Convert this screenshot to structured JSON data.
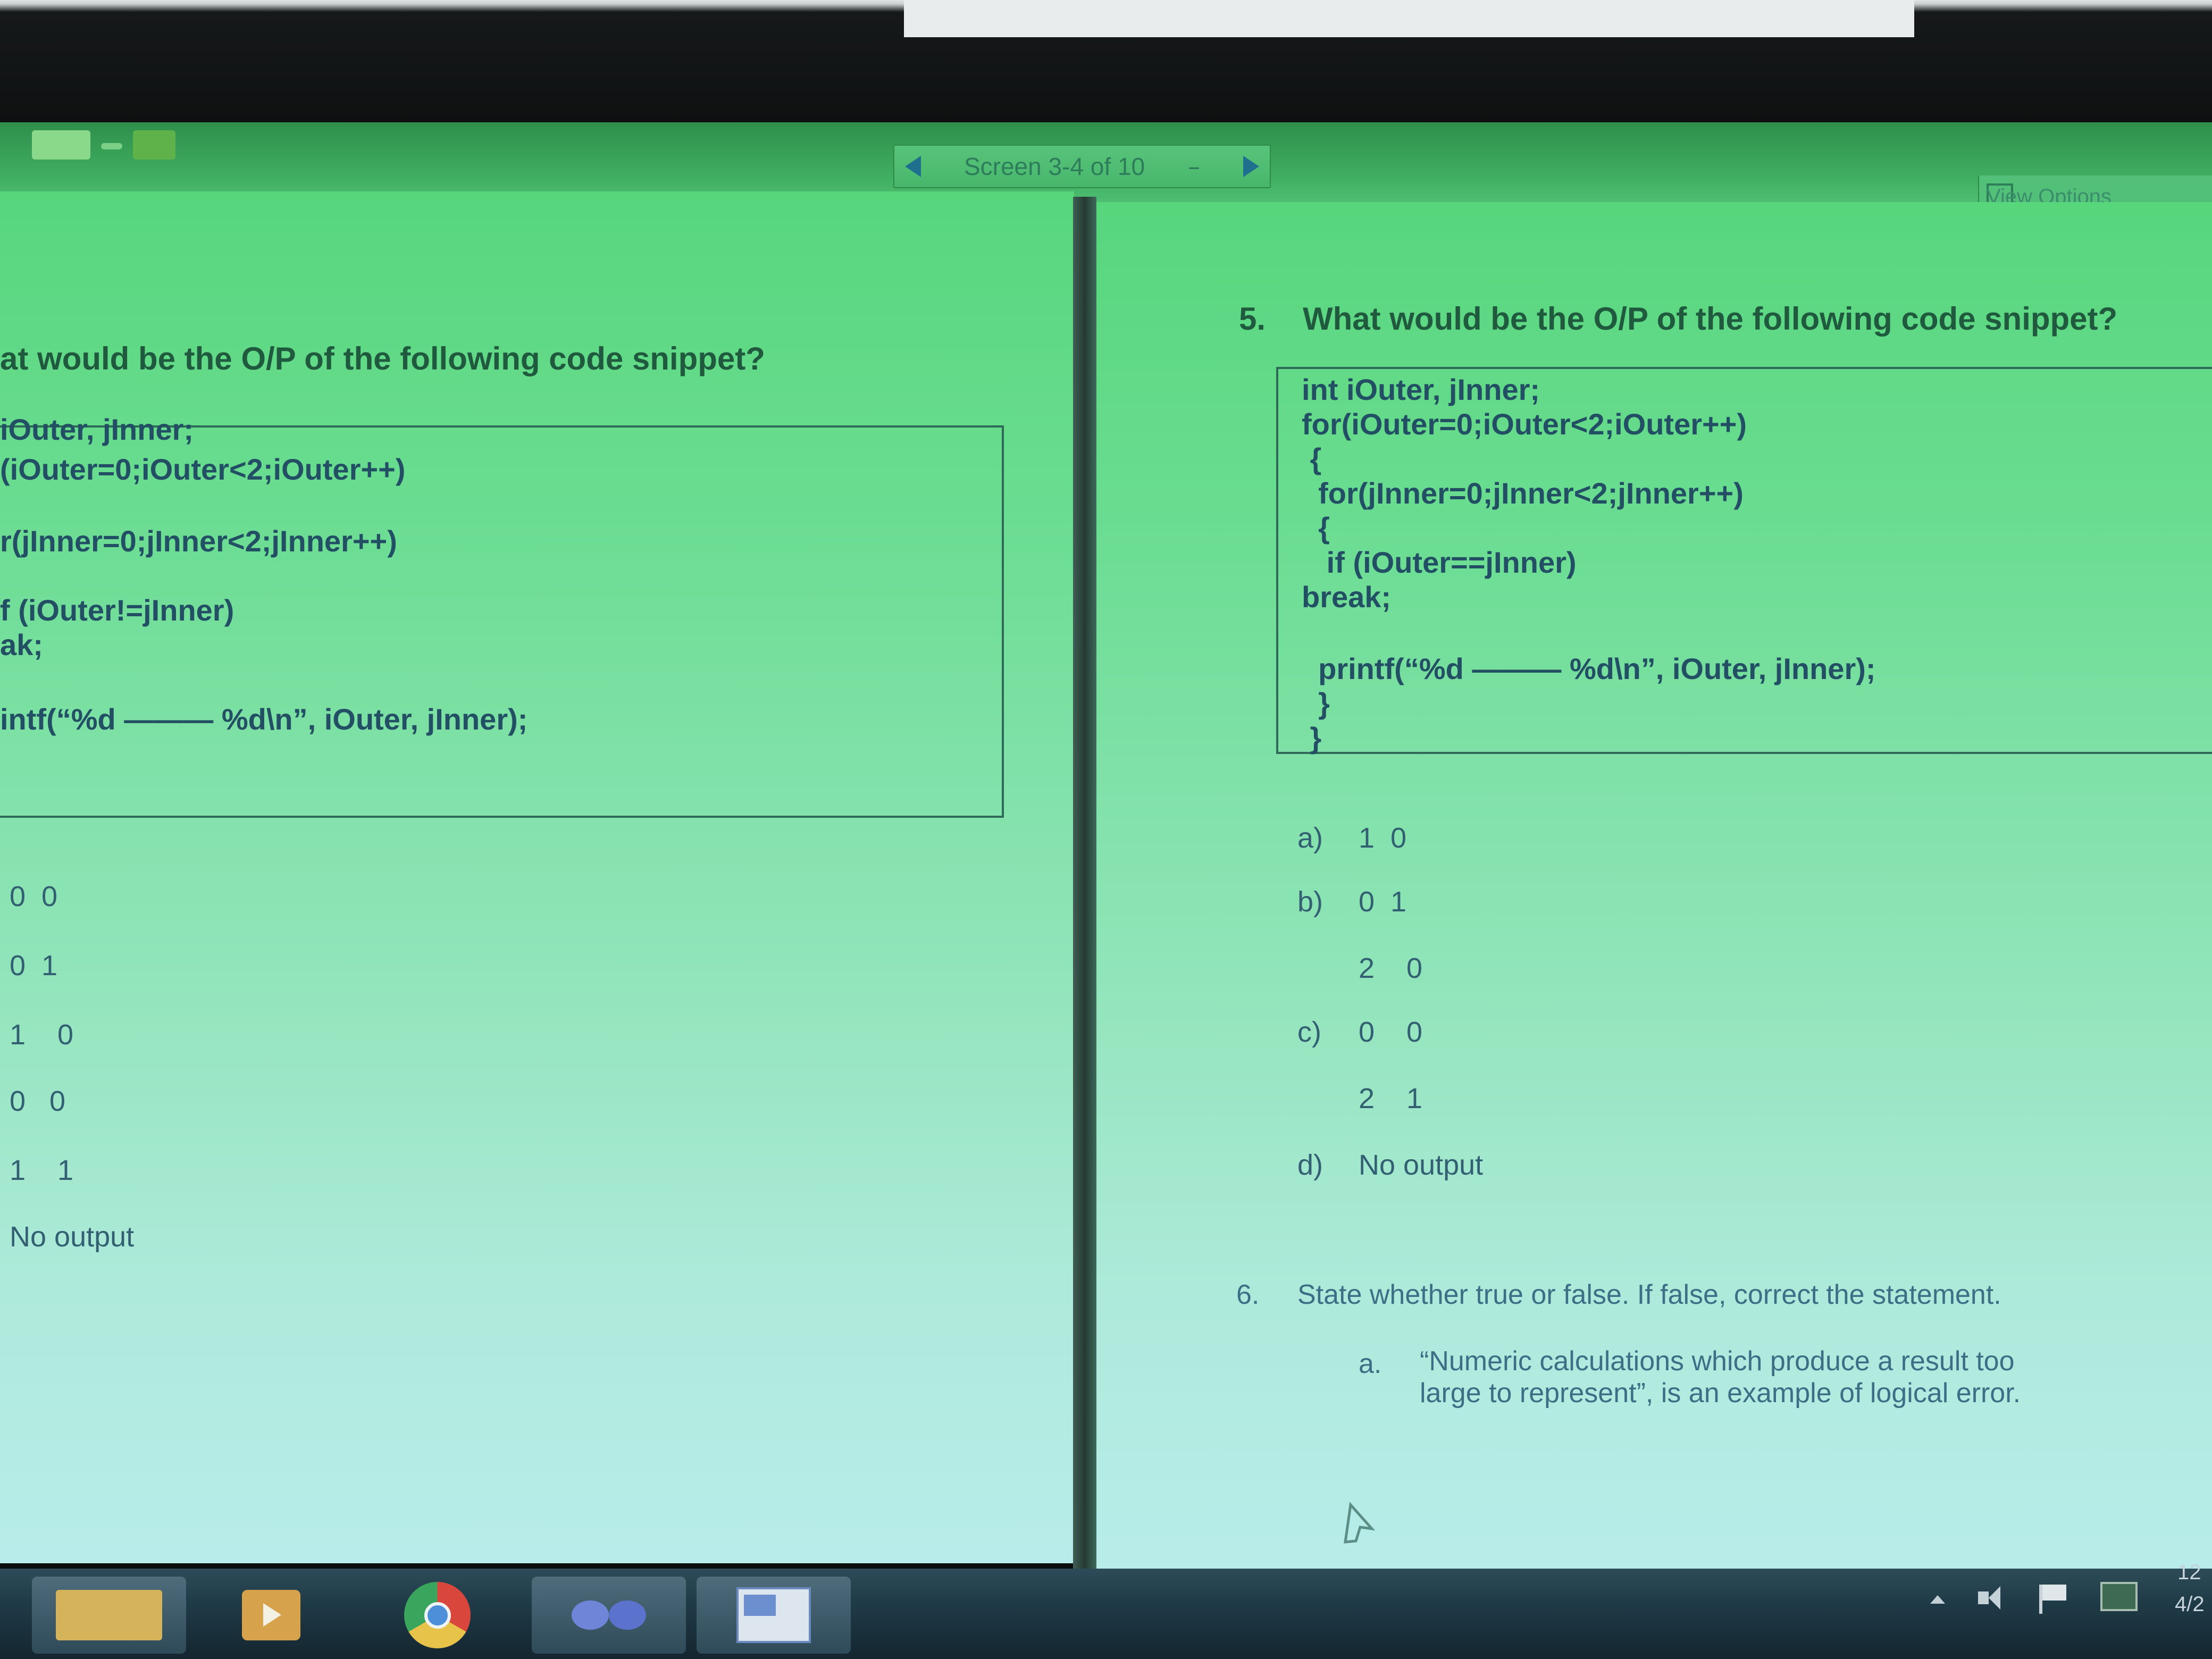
{
  "nav": {
    "screen_label": "Screen 3-4 of 10",
    "dash": "–"
  },
  "view_options": {
    "label": "View Options"
  },
  "left_page": {
    "question_title": "at would be the O/P of the following code snippet?",
    "code_lines": [
      "iOuter, jInner;",
      "(iOuter=0;iOuter<2;iOuter++)",
      "r(jInner=0;jInner<2;jInner++)",
      "f (iOuter!=jInner)",
      "ak;",
      "intf(“%d ——— %d\\n”, iOuter, jInner);"
    ],
    "options": [
      "0  0",
      "0  1",
      "1    0",
      "0   0",
      "1    1",
      "No output"
    ]
  },
  "right_page": {
    "q5": {
      "number": "5.",
      "title": "What would be the O/P of the following code snippet?"
    },
    "code_lines": [
      "int iOuter, jInner;",
      "for(iOuter=0;iOuter<2;iOuter++)",
      " {",
      "  for(jInner=0;jInner<2;jInner++)",
      "  {",
      "   if (iOuter==jInner)",
      "break;",
      "",
      "  printf(“%d ——— %d\\n”, iOuter, jInner);",
      "  }",
      " }"
    ],
    "options": [
      {
        "letter": "a)",
        "value": "1  0"
      },
      {
        "letter": "b)",
        "value": "0  1"
      },
      {
        "letter": "",
        "value": "2    0"
      },
      {
        "letter": "c)",
        "value": "0    0"
      },
      {
        "letter": "",
        "value": "2    1"
      },
      {
        "letter": "d)",
        "value": "No output"
      }
    ],
    "q6": {
      "number": "6.",
      "title": "State whether true or false. If false, correct the statement.",
      "item_letter": "a.",
      "item_line1": "“Numeric calculations which produce a result too",
      "item_line2": "large to represent”, is an example of logical error."
    }
  },
  "tray": {
    "time": "12",
    "date": "4/2"
  },
  "taskbar_icons": [
    "file-explorer-icon",
    "media-player-icon",
    "chrome-icon",
    "infinity-app-icon",
    "word-icon"
  ]
}
